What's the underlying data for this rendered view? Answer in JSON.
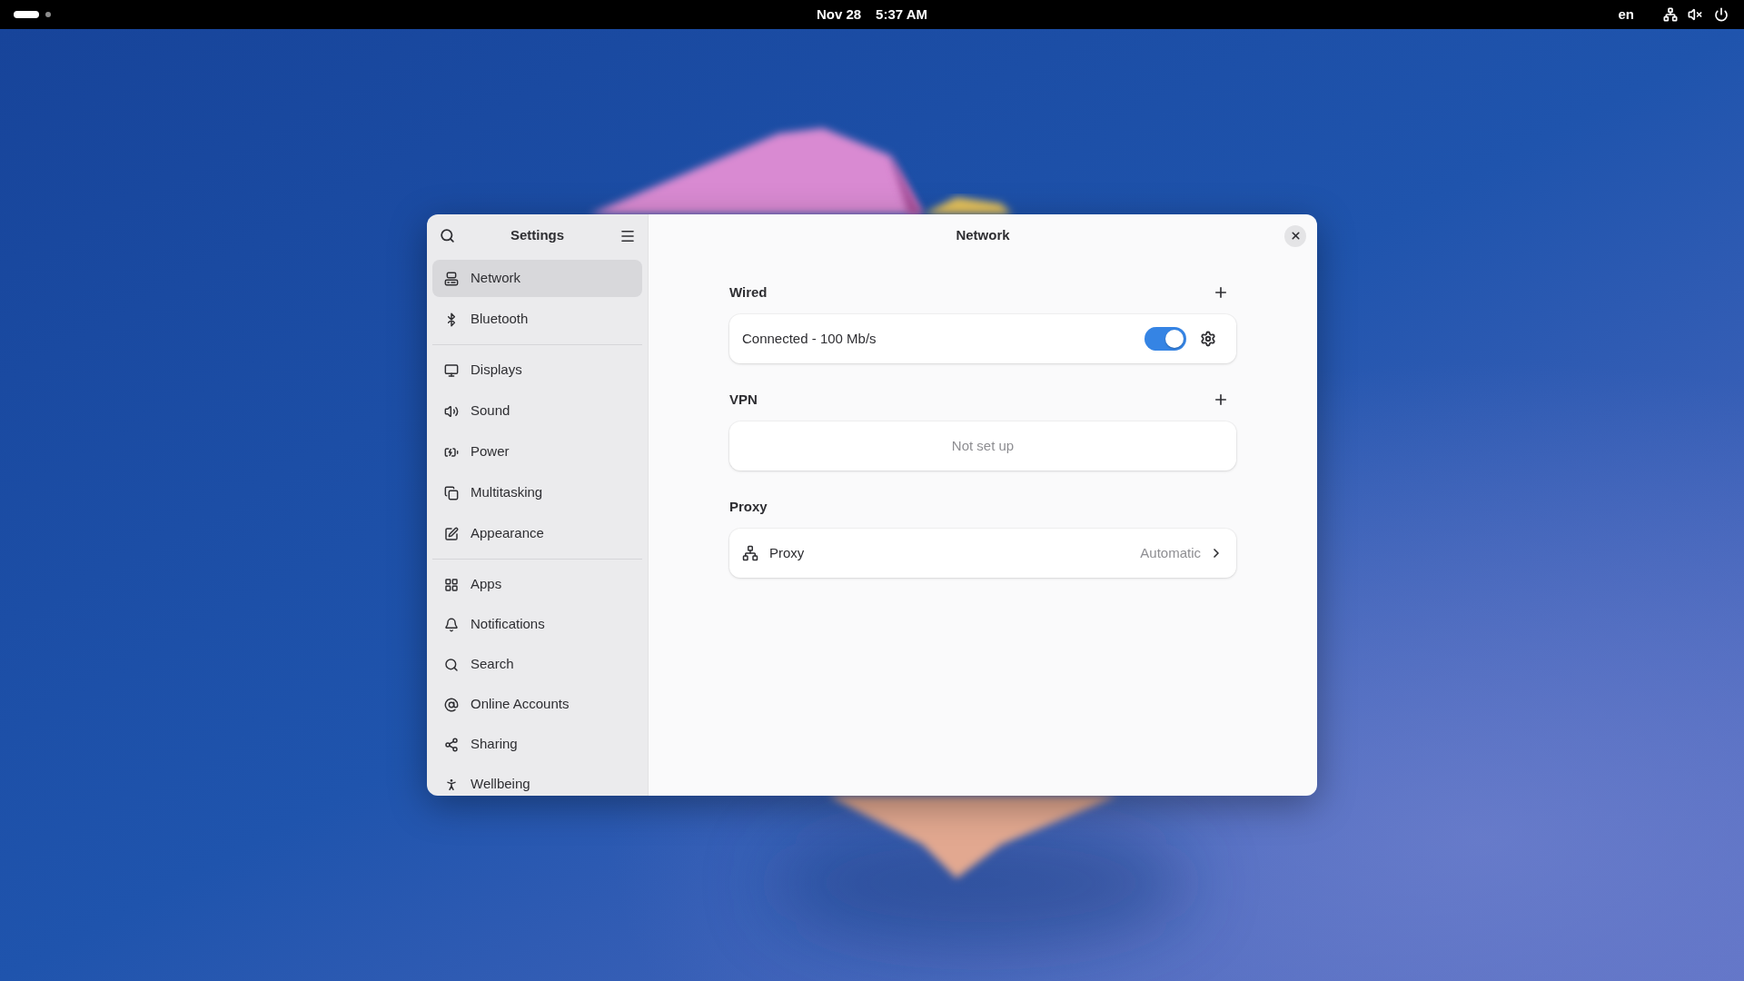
{
  "top_bar": {
    "workspaces": [
      {
        "selected": true
      },
      {
        "selected": false
      }
    ],
    "date": "Nov 28",
    "time": "5:37 AM",
    "keyboard_layout": "en",
    "sound_muted": true
  },
  "sidebar": {
    "title": "Settings",
    "groups": [
      {
        "items": [
          {
            "label": "Network",
            "selected": true
          },
          {
            "label": "Bluetooth",
            "selected": false
          }
        ]
      },
      {
        "items": [
          {
            "label": "Displays",
            "selected": false
          },
          {
            "label": "Sound",
            "selected": false
          },
          {
            "label": "Power",
            "selected": false
          },
          {
            "label": "Multitasking",
            "selected": false
          },
          {
            "label": "Appearance",
            "selected": false
          }
        ]
      },
      {
        "items": [
          {
            "label": "Apps",
            "selected": false
          },
          {
            "label": "Notifications",
            "selected": false
          },
          {
            "label": "Search",
            "selected": false
          },
          {
            "label": "Online Accounts",
            "selected": false
          },
          {
            "label": "Sharing",
            "selected": false
          },
          {
            "label": "Wellbeing",
            "selected": false
          }
        ]
      }
    ]
  },
  "page": {
    "title": "Network",
    "sections": [
      {
        "heading": "Wired",
        "addable": true,
        "rows": [
          {
            "kind": "switch",
            "label": "Connected - 100 Mb/s",
            "on": true
          }
        ]
      },
      {
        "heading": "VPN",
        "addable": true,
        "rows": [
          {
            "kind": "empty",
            "label": "Not set up"
          }
        ]
      },
      {
        "heading": "Proxy",
        "rows": [
          {
            "kind": "link",
            "label": "Proxy",
            "value": "Automatic"
          }
        ]
      }
    ]
  }
}
